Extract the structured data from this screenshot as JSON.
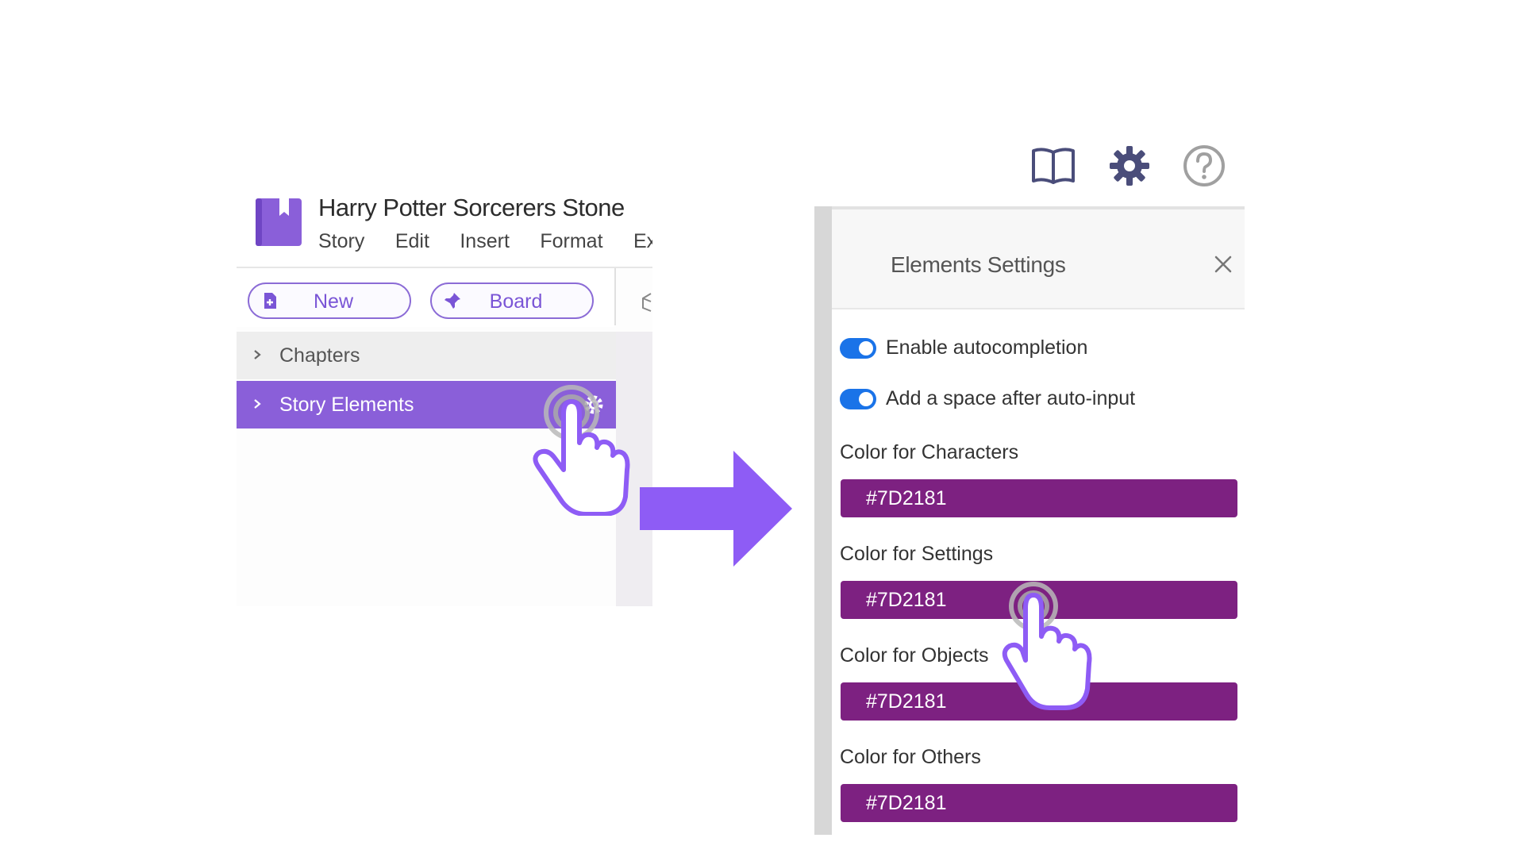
{
  "editor": {
    "document_title": "Harry Potter Sorcerers Stone",
    "menu": [
      "Story",
      "Edit",
      "Insert",
      "Format",
      "Ex|"
    ],
    "buttons": {
      "new_label": "New",
      "board_label": "Board"
    },
    "tree": {
      "chapters_label": "Chapters",
      "story_elements_label": "Story Elements"
    }
  },
  "top_icons": [
    "book-icon",
    "gear-icon",
    "help-icon"
  ],
  "settings": {
    "title": "Elements Settings",
    "toggles": [
      {
        "label": "Enable autocompletion",
        "on": true
      },
      {
        "label": "Add a space after auto-input",
        "on": true
      }
    ],
    "colors": [
      {
        "label": "Color for Characters",
        "value": "#7D2181"
      },
      {
        "label": "Color for Settings",
        "value": "#7D2181"
      },
      {
        "label": "Color for Objects",
        "value": "#7D2181"
      },
      {
        "label": "Color for Others",
        "value": "#7D2181"
      }
    ]
  },
  "theme": {
    "accent": "#8A5FD9",
    "toggle_on": "#1A73E8",
    "arrow": "#8E5CF5"
  }
}
